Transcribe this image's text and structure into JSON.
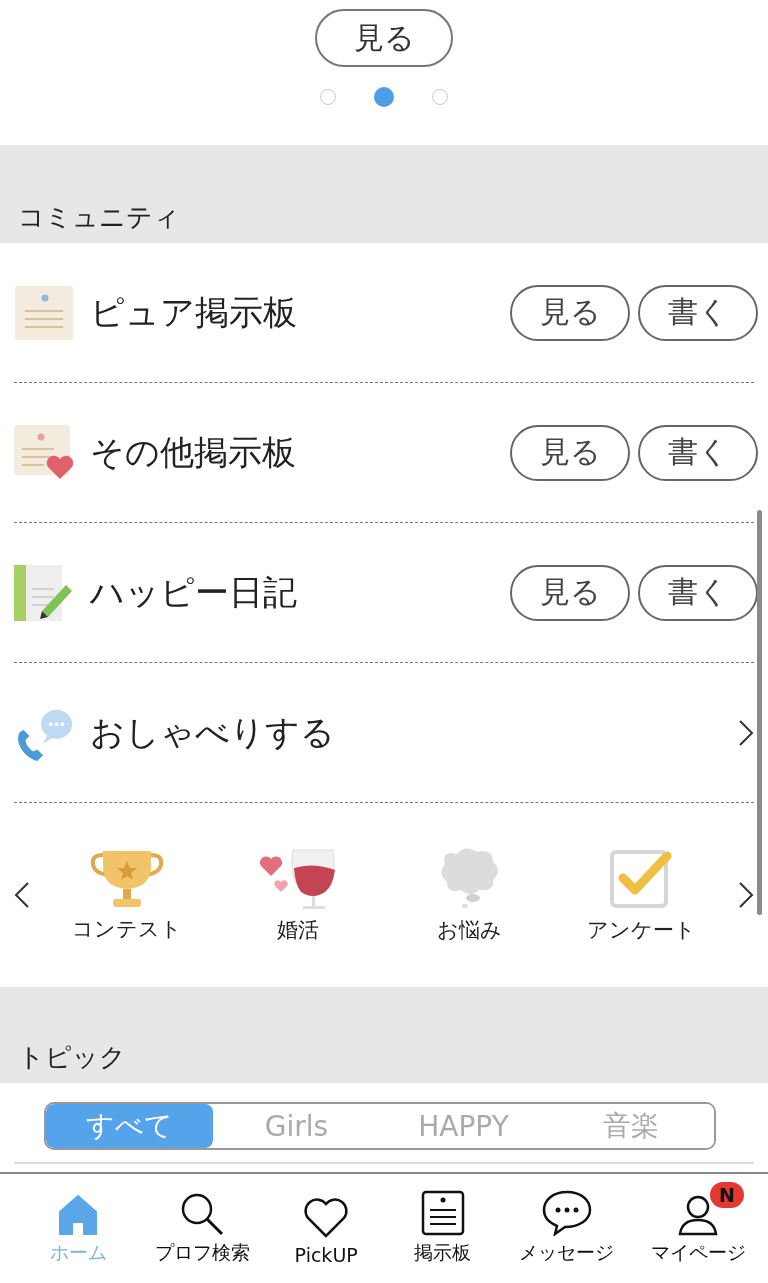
{
  "banner": {
    "button": "見る",
    "dots": [
      {
        "selected": false
      },
      {
        "selected": true
      },
      {
        "selected": false
      }
    ]
  },
  "community": {
    "title": "コミュニティ",
    "rows": [
      {
        "kind": "board",
        "label": "ピュア掲示板",
        "buttons": [
          "見る",
          "書く"
        ]
      },
      {
        "kind": "board",
        "label": "その他掲示板",
        "buttons": [
          "見る",
          "書く"
        ]
      },
      {
        "kind": "board",
        "label": "ハッピー日記",
        "buttons": [
          "見る",
          "書く"
        ]
      },
      {
        "kind": "link",
        "label": "おしゃべりする"
      }
    ],
    "features": [
      "コンテスト",
      "婚活",
      "お悩み",
      "アンケート"
    ]
  },
  "topics": {
    "title": "トピック",
    "tabs": [
      {
        "label": "すべて",
        "selected": true
      },
      {
        "label": "Girls",
        "selected": false
      },
      {
        "label": "HAPPY",
        "selected": false
      },
      {
        "label": "音楽",
        "selected": false
      }
    ]
  },
  "nav": [
    {
      "label": "ホーム",
      "selected": true
    },
    {
      "label": "プロフ検索",
      "selected": false
    },
    {
      "label": "PickUP",
      "selected": false
    },
    {
      "label": "掲示板",
      "selected": false
    },
    {
      "label": "メッセージ",
      "selected": false
    },
    {
      "label": "マイページ",
      "selected": false,
      "badge": "N"
    }
  ]
}
